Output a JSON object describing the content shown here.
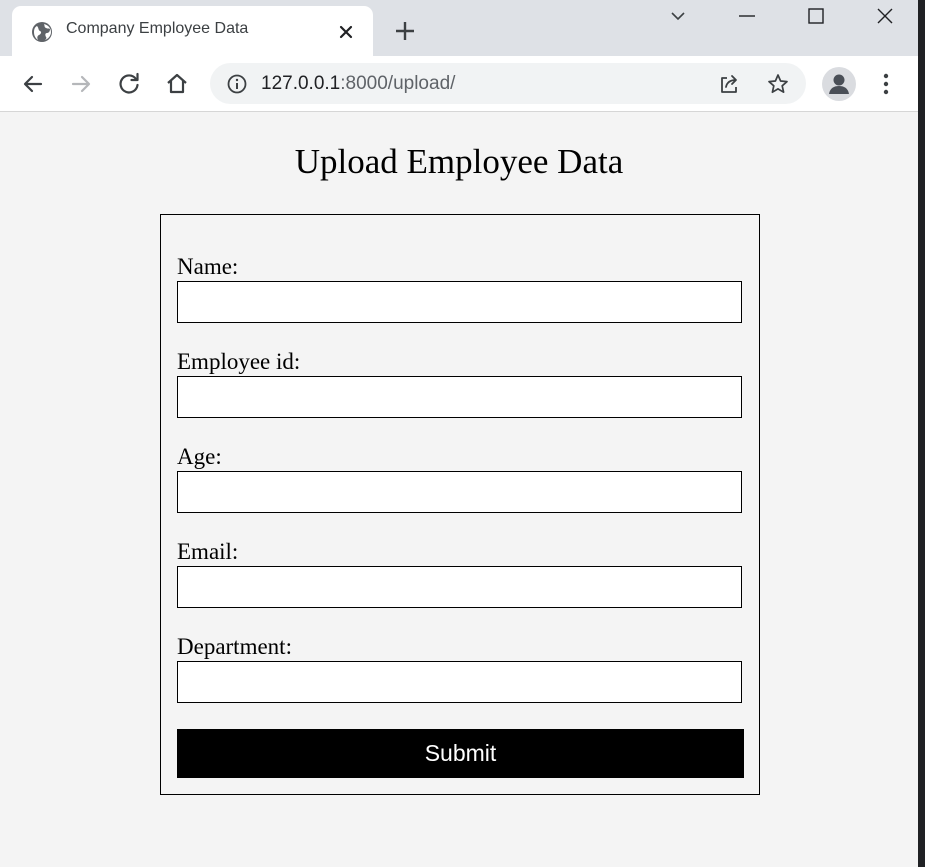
{
  "browser": {
    "tab": {
      "title": "Company Employee Data",
      "favicon": "globe-icon",
      "close_icon": "close-icon"
    },
    "new_tab_icon": "plus-icon",
    "window_controls": [
      "tab-search-icon",
      "minimize-icon",
      "maximize-icon",
      "close-window-icon"
    ],
    "nav": [
      "back-icon",
      "forward-icon",
      "reload-icon",
      "home-icon"
    ],
    "address": {
      "host": "127.0.0.1",
      "rest": ":8000/upload/",
      "info_icon": "info-icon"
    },
    "actions": [
      "share-icon",
      "star-icon",
      "profile-avatar",
      "menu-dots-icon"
    ]
  },
  "page": {
    "title": "Upload Employee Data",
    "fields": [
      {
        "label": "Name:",
        "value": "",
        "placeholder": ""
      },
      {
        "label": "Employee id:",
        "value": "",
        "placeholder": ""
      },
      {
        "label": "Age:",
        "value": "",
        "placeholder": ""
      },
      {
        "label": "Email:",
        "value": "",
        "placeholder": ""
      },
      {
        "label": "Department:",
        "value": "",
        "placeholder": ""
      }
    ],
    "submit_label": "Submit"
  },
  "colors": {
    "tabstrip": "#dee1e6",
    "page_background": "#f4f4f4",
    "button_background": "#000000",
    "button_text": "#ffffff"
  }
}
